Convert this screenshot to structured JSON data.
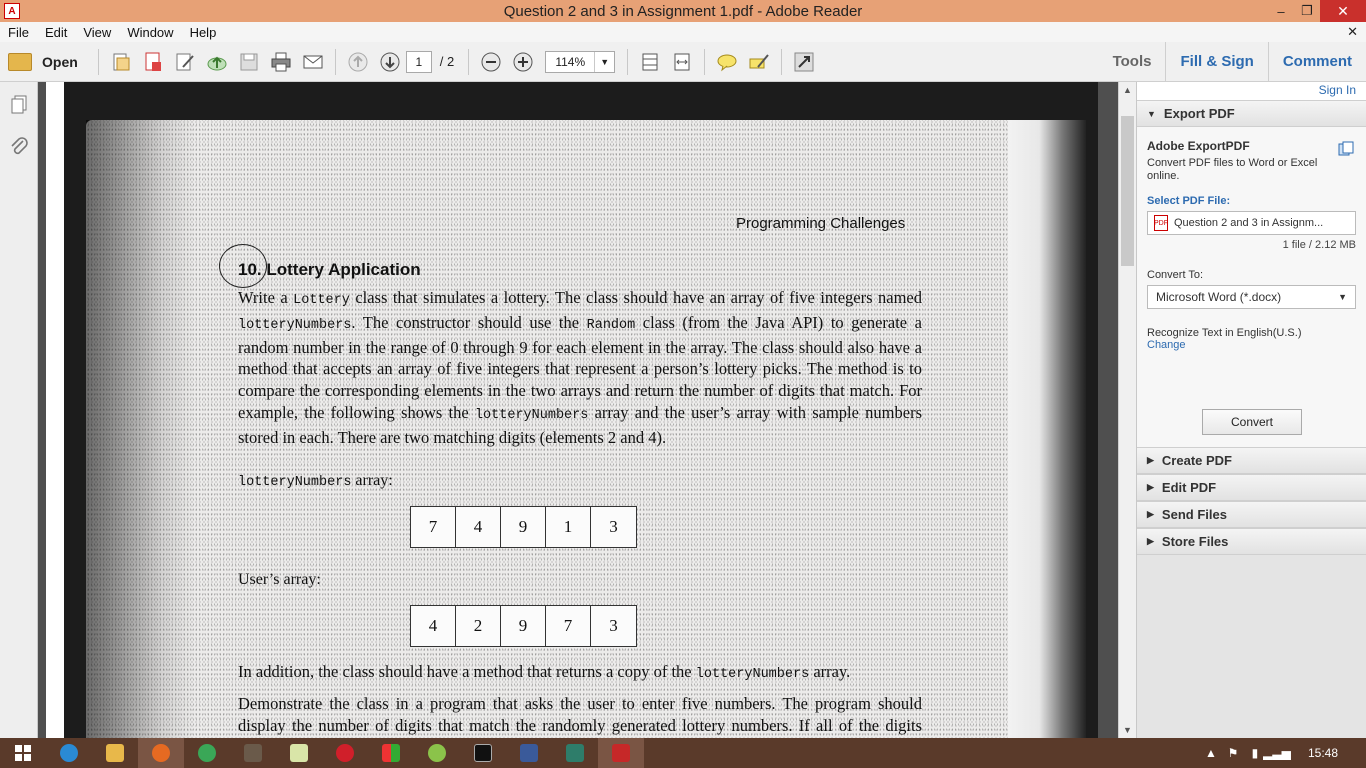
{
  "window": {
    "title": "Question 2 and 3 in Assignment 1.pdf - Adobe Reader",
    "minimize": "–",
    "maximize": "❐",
    "close": "✕",
    "doc_close": "✕"
  },
  "menu": [
    "File",
    "Edit",
    "View",
    "Window",
    "Help"
  ],
  "toolbar": {
    "open_label": "Open",
    "page_current": "1",
    "page_total": "/ 2",
    "zoom": "114%",
    "tools": "Tools",
    "fill_sign": "Fill & Sign",
    "comment": "Comment"
  },
  "document": {
    "running_head": "Programming Challenges",
    "section_title": "10. Lottery Application",
    "para1_parts": [
      "Write a ",
      "Lottery",
      " class that simulates a lottery. The class should have an array of five integers named ",
      "lotteryNumbers",
      ". The constructor should use the ",
      "Random",
      " class (from the Java API) to generate a random number in the range of 0 through 9 for each element in the array. The class should also have a method that accepts an array of five integers that represent a person’s lottery picks. The method is to compare the corresponding elements in the two arrays and return the number of digits that match. For example, the following shows the ",
      "lotteryNumbers",
      " array and the user’s array with sample numbers stored in each. There are two matching digits (elements 2 and 4)."
    ],
    "label1_code": "lotteryNumbers",
    "label1_rest": " array:",
    "array1": [
      "7",
      "4",
      "9",
      "1",
      "3"
    ],
    "label2": "User’s array:",
    "array2": [
      "4",
      "2",
      "9",
      "7",
      "3"
    ],
    "para2_a": "In addition, the class should have a method that returns a copy of the ",
    "para2_code": "lotteryNumbers",
    "para2_b": " array.",
    "para3": "Demonstrate the class in a program that asks the user to enter five numbers. The program should display the number of digits that match the randomly generated lottery numbers. If all of the digits match, display a message proclaiming the user a grand prize winner."
  },
  "panel": {
    "sign_in": "Sign In",
    "export_header": "Export PDF",
    "export_title": "Adobe ExportPDF",
    "export_desc": "Convert PDF files to Word or Excel online.",
    "select_label": "Select PDF File:",
    "selected_file": "Question 2 and 3 in Assignm...",
    "file_size": "1 file / 2.12 MB",
    "convert_to_label": "Convert To:",
    "convert_to_value": "Microsoft Word (*.docx)",
    "recognize": "Recognize Text in English(U.S.)",
    "change": "Change",
    "convert_button": "Convert",
    "sections": [
      "Create PDF",
      "Edit PDF",
      "Send Files",
      "Store Files"
    ]
  },
  "taskbar": {
    "clock": "15:48"
  }
}
